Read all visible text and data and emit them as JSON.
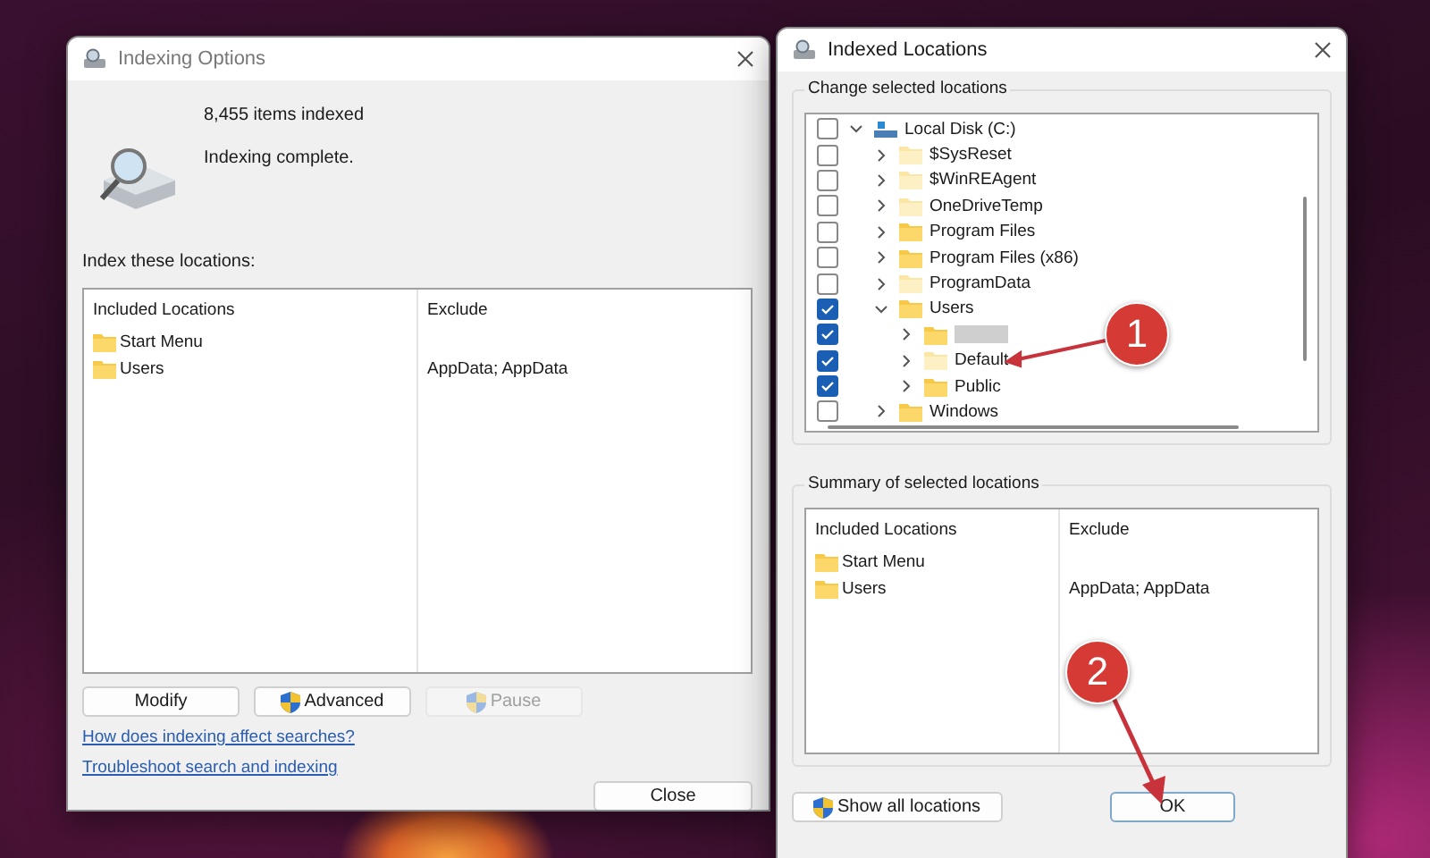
{
  "indexing_options": {
    "title": "Indexing Options",
    "items_indexed": "8,455 items indexed",
    "status": "Indexing complete.",
    "locations_label": "Index these locations:",
    "columns": [
      "Included Locations",
      "Exclude"
    ],
    "rows": [
      {
        "location": "Start Menu",
        "exclude": ""
      },
      {
        "location": "Users",
        "exclude": "AppData; AppData"
      }
    ],
    "buttons": [
      {
        "label": "Modify",
        "shield": false,
        "disabled": false
      },
      {
        "label": "Advanced",
        "shield": true,
        "disabled": false
      },
      {
        "label": "Pause",
        "shield": true,
        "disabled": true
      }
    ],
    "links": [
      "How does indexing affect searches?",
      "Troubleshoot search and indexing"
    ],
    "close_button": "Close"
  },
  "indexed_locations": {
    "title": "Indexed Locations",
    "change_label": "Change selected locations",
    "tree": [
      {
        "kind": "drive",
        "label": "Local Disk (C:)",
        "checked": false,
        "expanded": true,
        "children": [
          {
            "kind": "folder",
            "label": "$SysReset",
            "checked": false,
            "expanded": false,
            "hidden": true
          },
          {
            "kind": "folder",
            "label": "$WinREAgent",
            "checked": false,
            "expanded": false,
            "hidden": true
          },
          {
            "kind": "folder",
            "label": "OneDriveTemp",
            "checked": false,
            "expanded": false,
            "hidden": true
          },
          {
            "kind": "folder",
            "label": "Program Files",
            "checked": false,
            "expanded": false,
            "hidden": false
          },
          {
            "kind": "folder",
            "label": "Program Files (x86)",
            "checked": false,
            "expanded": false,
            "hidden": false
          },
          {
            "kind": "folder",
            "label": "ProgramData",
            "checked": false,
            "expanded": false,
            "hidden": true
          },
          {
            "kind": "folder",
            "label": "Users",
            "checked": true,
            "expanded": true,
            "hidden": false,
            "children": [
              {
                "kind": "redacted",
                "checked": true,
                "expanded": false,
                "hidden": false
              },
              {
                "kind": "folder",
                "label": "Default",
                "checked": true,
                "expanded": false,
                "hidden": true
              },
              {
                "kind": "folder",
                "label": "Public",
                "checked": true,
                "expanded": false,
                "hidden": false
              }
            ]
          },
          {
            "kind": "folder",
            "label": "Windows",
            "checked": false,
            "expanded": false,
            "hidden": false
          }
        ]
      }
    ],
    "summary_label": "Summary of selected locations",
    "columns": [
      "Included Locations",
      "Exclude"
    ],
    "rows": [
      {
        "location": "Start Menu",
        "exclude": ""
      },
      {
        "location": "Users",
        "exclude": "AppData; AppData"
      }
    ],
    "show_all_button": "Show all locations",
    "ok_button": "OK"
  },
  "annotations": [
    {
      "label": "1"
    },
    {
      "label": "2"
    }
  ]
}
